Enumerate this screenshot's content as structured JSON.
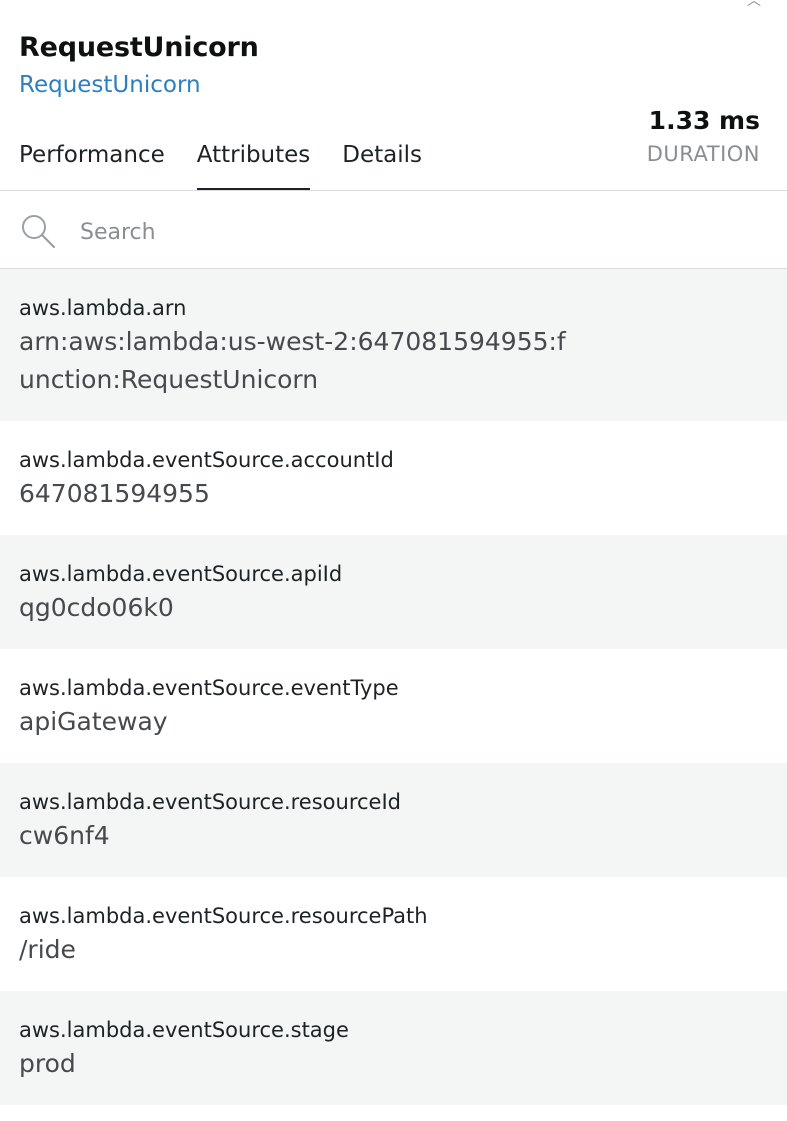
{
  "header": {
    "title": "RequestUnicorn",
    "subtitle": "RequestUnicorn",
    "tabs": [
      {
        "label": "Performance",
        "active": false
      },
      {
        "label": "Attributes",
        "active": true
      },
      {
        "label": "Details",
        "active": false
      }
    ],
    "duration": {
      "value": "1.33 ms",
      "label": "DURATION"
    }
  },
  "search": {
    "placeholder": "Search",
    "value": ""
  },
  "attributes": [
    {
      "key": "aws.lambda.arn",
      "value": "arn:aws:lambda:us-west-2:647081594955:function:RequestUnicorn"
    },
    {
      "key": "aws.lambda.eventSource.accountId",
      "value": "647081594955"
    },
    {
      "key": "aws.lambda.eventSource.apiId",
      "value": "qg0cdo06k0"
    },
    {
      "key": "aws.lambda.eventSource.eventType",
      "value": "apiGateway"
    },
    {
      "key": "aws.lambda.eventSource.resourceId",
      "value": "cw6nf4"
    },
    {
      "key": "aws.lambda.eventSource.resourcePath",
      "value": "/ride"
    },
    {
      "key": "aws.lambda.eventSource.stage",
      "value": "prod"
    }
  ],
  "colors": {
    "link": "#2d7fc1",
    "row_alt": "#f4f5f5",
    "divider": "#d9dadb",
    "muted": "#8a8e92"
  }
}
